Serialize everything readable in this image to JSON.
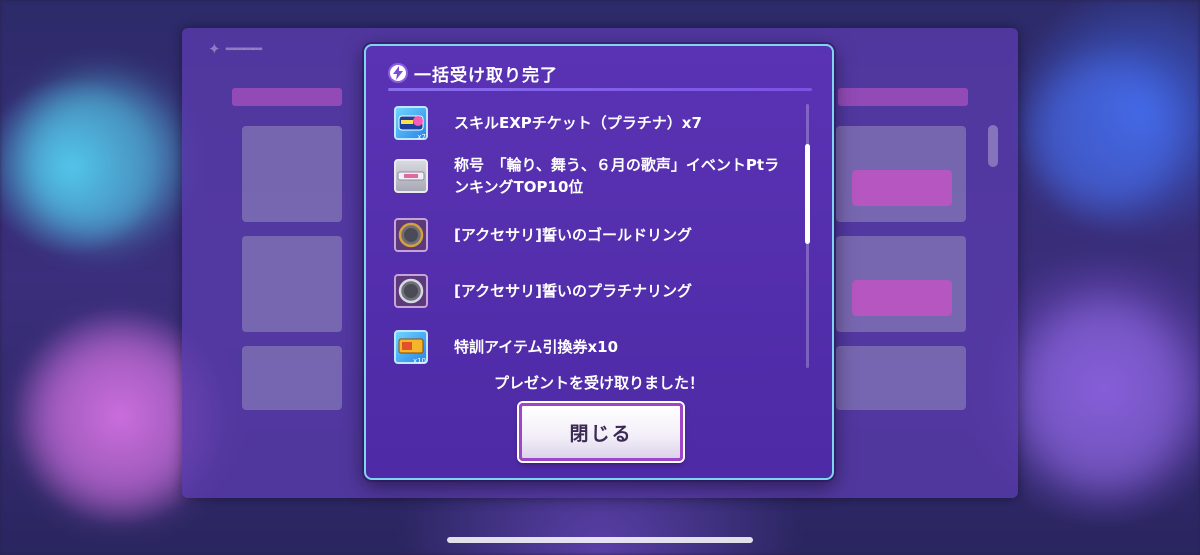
{
  "dialog": {
    "title": "一括受け取り完了",
    "items": [
      {
        "label": "スキルEXPチケット（プラチナ）x7",
        "icon": "skill-exp-ticket-icon",
        "badge": "x7"
      },
      {
        "label": "称号　「輪り、舞う、６月の歌声」イベントPtランキングTOP10位",
        "icon": "title-plate-icon",
        "badge": ""
      },
      {
        "label": "[アクセサリ]誓いのゴールドリング",
        "icon": "gold-ring-icon",
        "badge": ""
      },
      {
        "label": "[アクセサリ]誓いのプラチナリング",
        "icon": "platinum-ring-icon",
        "badge": ""
      },
      {
        "label": "特訓アイテム引換券x10",
        "icon": "training-voucher-icon",
        "badge": "x10"
      }
    ],
    "message": "プレゼントを受け取りました！",
    "close_label": "閉じる"
  },
  "colors": {
    "dialog_bg": "#5230ac",
    "dialog_border": "#7fd4ef",
    "button_border": "#a045c8",
    "text": "#ffffff"
  }
}
